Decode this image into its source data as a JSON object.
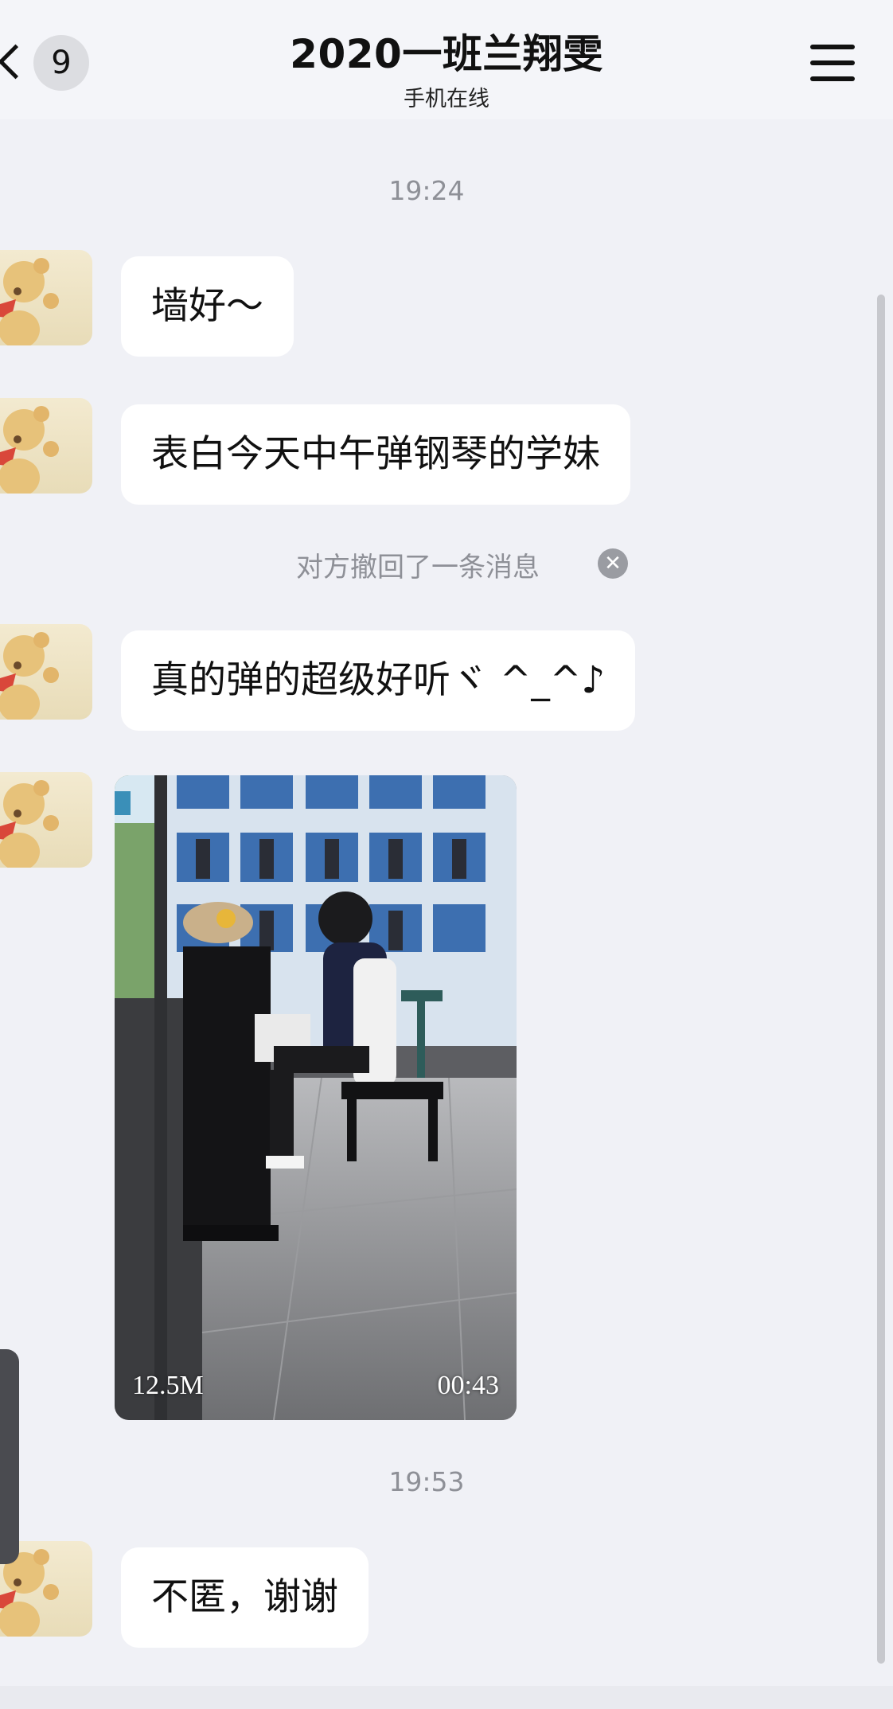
{
  "header": {
    "back_icon": "chevron-left-icon",
    "unread_count": "9",
    "title": "2020一班兰翔雯",
    "subtitle": "手机在线",
    "menu_icon": "hamburger-menu-icon"
  },
  "messages": {
    "time1": "19:24",
    "msg1": "墙好～",
    "msg2": "表白今天中午弹钢琴的学妹",
    "recall_notice": "对方撤回了一条消息",
    "recall_close_icon": "close-circle-icon",
    "msg3": "真的弹的超级好听ヾ ^_^♪",
    "video": {
      "size": "12.5M",
      "duration": "00:43"
    },
    "time2": "19:53",
    "msg4": "不匿，谢谢"
  },
  "colors": {
    "background": "#f0f1f6",
    "bubble": "#ffffff",
    "meta_text": "#8e9097"
  }
}
